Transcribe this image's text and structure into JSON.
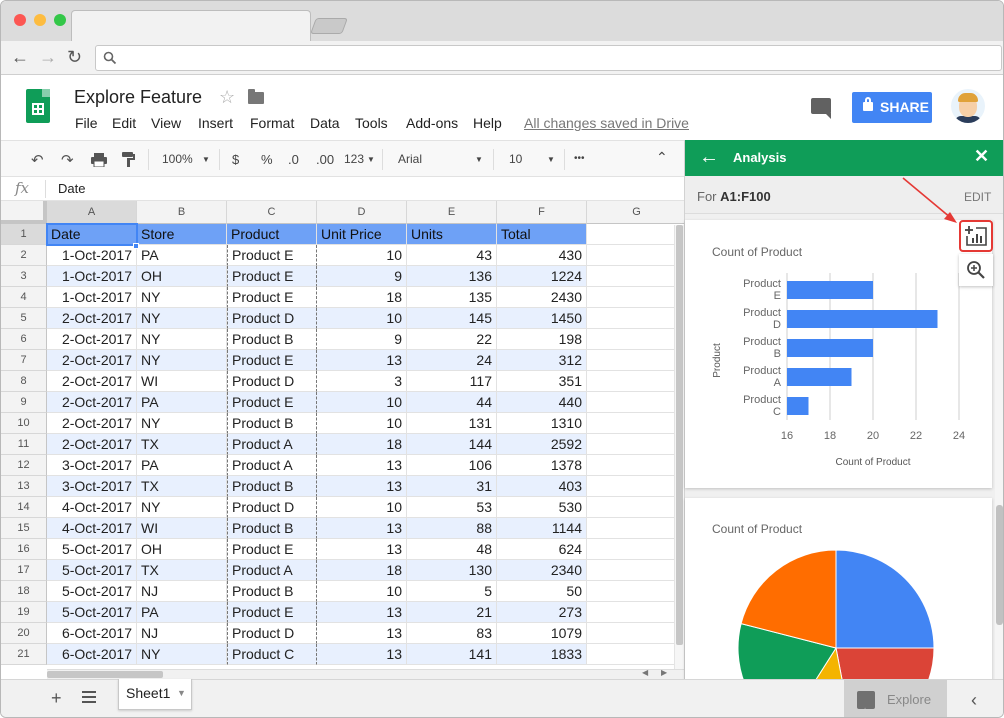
{
  "doc": {
    "title": "Explore Feature",
    "menus": [
      "File",
      "Edit",
      "View",
      "Insert",
      "Format",
      "Data",
      "Tools",
      "Add-ons",
      "Help"
    ],
    "saved_status": "All changes saved in Drive",
    "share_label": "SHARE"
  },
  "toolbar": {
    "zoom": "100%",
    "currency": "$",
    "percent": "%",
    "decrease_decimals": ".0",
    "increase_decimals": ".00",
    "more_formats": "123",
    "font": "Arial",
    "font_size": "10",
    "more": "•••"
  },
  "formula_bar": {
    "fx": "fx",
    "value": "Date"
  },
  "columns": [
    "A",
    "B",
    "C",
    "D",
    "E",
    "F",
    "G"
  ],
  "header_row": [
    "Date",
    "Store",
    "Product",
    "Unit Price",
    "Units",
    "Total"
  ],
  "rows": [
    [
      "1-Oct-2017",
      "PA",
      "Product E",
      "10",
      "43",
      "430"
    ],
    [
      "1-Oct-2017",
      "OH",
      "Product E",
      "9",
      "136",
      "1224"
    ],
    [
      "1-Oct-2017",
      "NY",
      "Product E",
      "18",
      "135",
      "2430"
    ],
    [
      "2-Oct-2017",
      "NY",
      "Product D",
      "10",
      "145",
      "1450"
    ],
    [
      "2-Oct-2017",
      "NY",
      "Product B",
      "9",
      "22",
      "198"
    ],
    [
      "2-Oct-2017",
      "NY",
      "Product E",
      "13",
      "24",
      "312"
    ],
    [
      "2-Oct-2017",
      "WI",
      "Product D",
      "3",
      "117",
      "351"
    ],
    [
      "2-Oct-2017",
      "PA",
      "Product E",
      "10",
      "44",
      "440"
    ],
    [
      "2-Oct-2017",
      "NY",
      "Product B",
      "10",
      "131",
      "1310"
    ],
    [
      "2-Oct-2017",
      "TX",
      "Product A",
      "18",
      "144",
      "2592"
    ],
    [
      "3-Oct-2017",
      "PA",
      "Product A",
      "13",
      "106",
      "1378"
    ],
    [
      "3-Oct-2017",
      "TX",
      "Product B",
      "13",
      "31",
      "403"
    ],
    [
      "4-Oct-2017",
      "NY",
      "Product D",
      "10",
      "53",
      "530"
    ],
    [
      "4-Oct-2017",
      "WI",
      "Product B",
      "13",
      "88",
      "1144"
    ],
    [
      "5-Oct-2017",
      "OH",
      "Product E",
      "13",
      "48",
      "624"
    ],
    [
      "5-Oct-2017",
      "TX",
      "Product A",
      "18",
      "130",
      "2340"
    ],
    [
      "5-Oct-2017",
      "NJ",
      "Product B",
      "10",
      "5",
      "50"
    ],
    [
      "5-Oct-2017",
      "PA",
      "Product E",
      "13",
      "21",
      "273"
    ],
    [
      "6-Oct-2017",
      "NJ",
      "Product D",
      "13",
      "83",
      "1079"
    ],
    [
      "6-Oct-2017",
      "NY",
      "Product C",
      "13",
      "141",
      "1833"
    ]
  ],
  "bottom": {
    "sheet_name": "Sheet1",
    "explore_label": "Explore"
  },
  "panel": {
    "title": "Analysis",
    "range_prefix": "For ",
    "range": "A1:F100",
    "edit_label": "EDIT"
  },
  "colors": {
    "sheets_green": "#0f9d58",
    "header_blue": "#6ea1f6",
    "band_blue": "#e8f0fe",
    "share_blue": "#4285f4",
    "bar_blue": "#4285f4",
    "callout_red": "#e53935"
  },
  "chart_data": [
    {
      "type": "bar",
      "orientation": "horizontal",
      "title": "Count of Product",
      "xlabel": "Count of Product",
      "ylabel": "Product",
      "categories": [
        "Product E",
        "Product D",
        "Product B",
        "Product A",
        "Product C"
      ],
      "category_lines": [
        [
          "Product",
          "E"
        ],
        [
          "Product",
          "D"
        ],
        [
          "Product",
          "B"
        ],
        [
          "Product",
          "A"
        ],
        [
          "Product",
          "C"
        ]
      ],
      "values": [
        20,
        23,
        20,
        19,
        17
      ],
      "xlim": [
        16,
        24
      ],
      "xticks": [
        "16",
        "18",
        "20",
        "22",
        "24"
      ],
      "grid": true,
      "color": "#4285f4"
    },
    {
      "type": "pie",
      "title": "Count of Product",
      "slices": [
        {
          "color": "#4285f4",
          "value": 25
        },
        {
          "color": "#db4437",
          "value": 22
        },
        {
          "color": "#f4b400",
          "value": 12
        },
        {
          "color": "#0f9d58",
          "value": 20
        },
        {
          "color": "#ff6d00",
          "value": 21
        }
      ]
    }
  ]
}
